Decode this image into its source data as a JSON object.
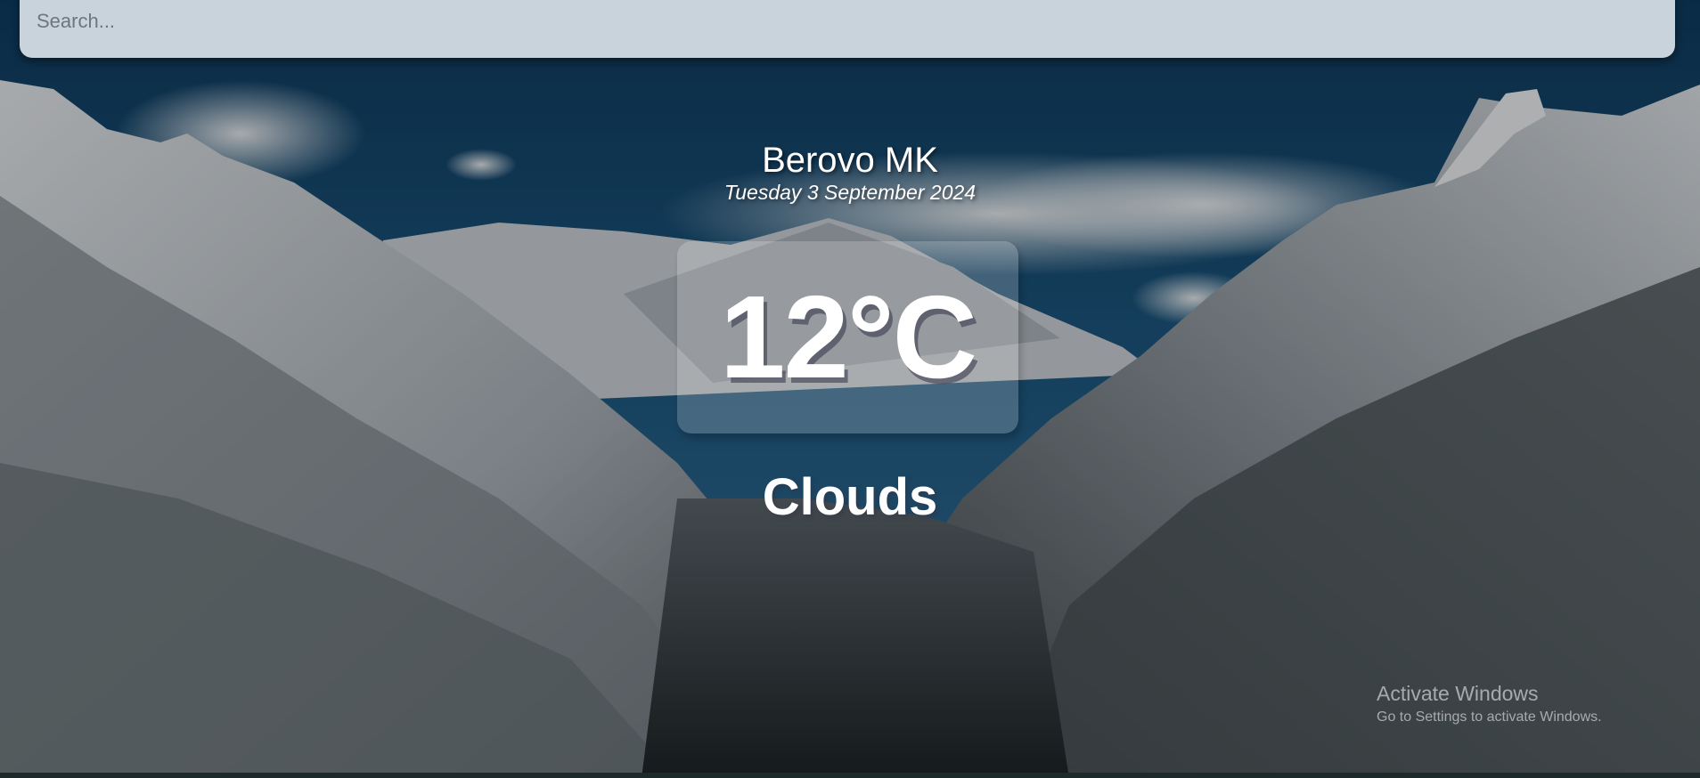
{
  "search": {
    "placeholder": "Search..."
  },
  "location": {
    "city": "Berovo MK",
    "date": "Tuesday 3 September 2024"
  },
  "weather": {
    "temperature": "12°C",
    "condition": "Clouds"
  },
  "watermark": {
    "title": "Activate Windows",
    "subtitle": "Go to Settings to activate Windows."
  },
  "background": {
    "sky_color": "#1b4a6e",
    "mountain_color": "#c9cfd4",
    "overlay_color": "#000000"
  }
}
